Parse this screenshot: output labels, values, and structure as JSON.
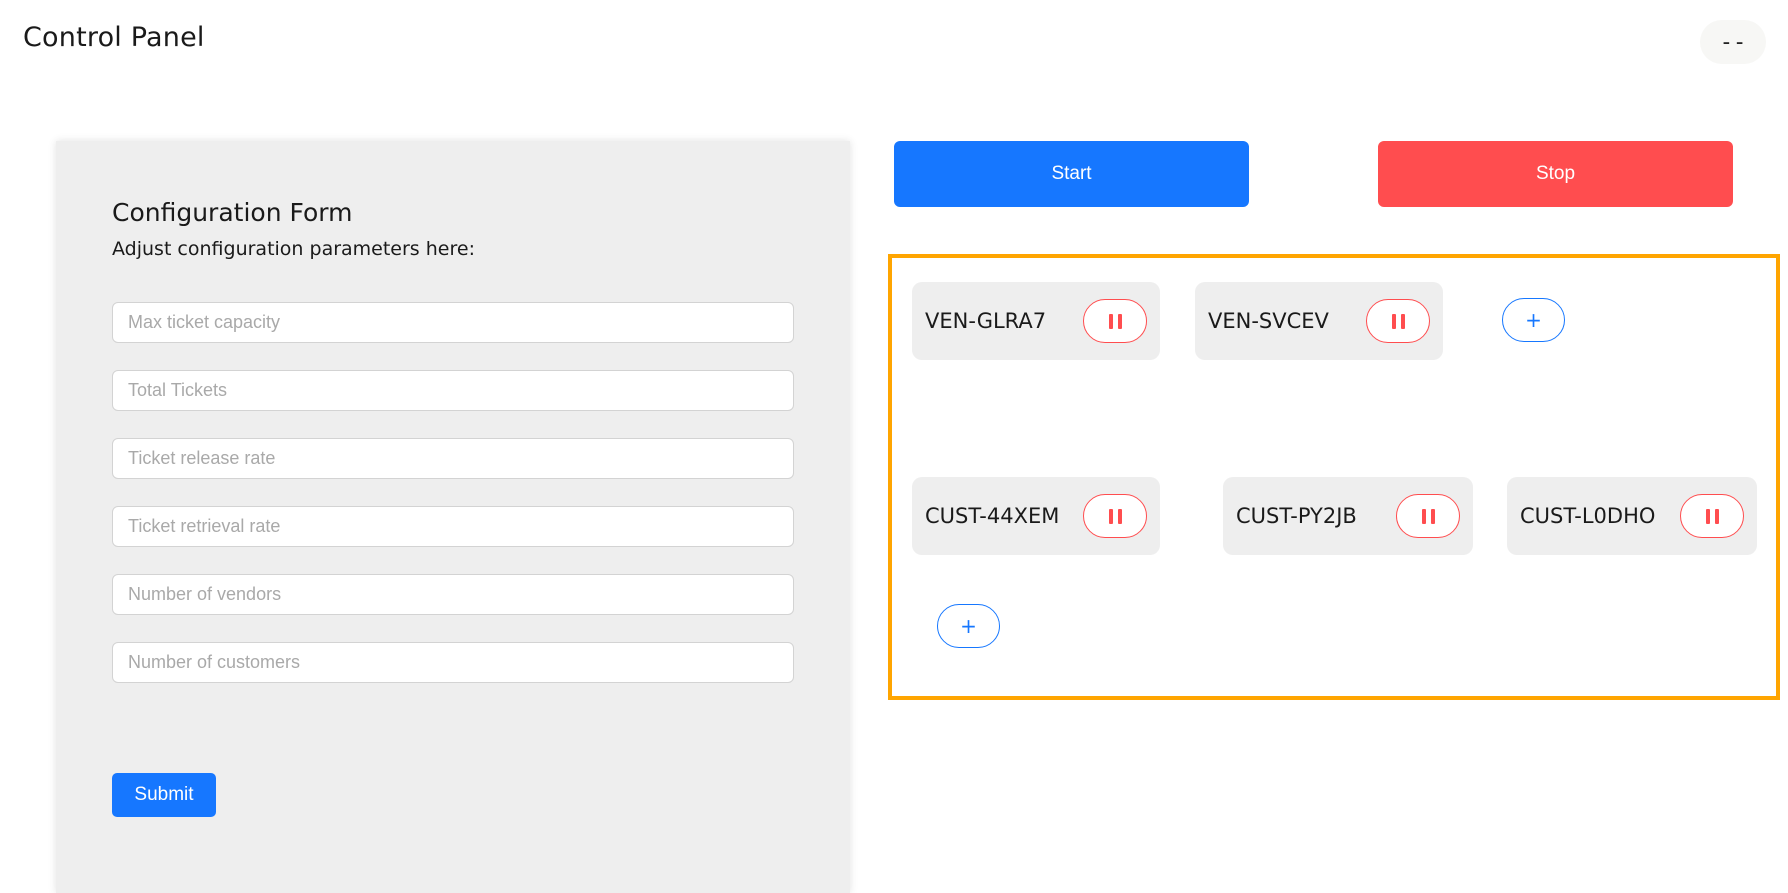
{
  "header": {
    "title": "Control Panel",
    "user_label": "--"
  },
  "form": {
    "title": "Configuration Form",
    "subtitle": "Adjust configuration parameters here:",
    "fields": [
      {
        "placeholder": "Max ticket capacity",
        "value": ""
      },
      {
        "placeholder": "Total Tickets",
        "value": ""
      },
      {
        "placeholder": "Ticket release rate",
        "value": ""
      },
      {
        "placeholder": "Ticket retrieval rate",
        "value": ""
      },
      {
        "placeholder": "Number of vendors",
        "value": ""
      },
      {
        "placeholder": "Number of customers",
        "value": ""
      }
    ],
    "submit_label": "Submit"
  },
  "actions": {
    "start_label": "Start",
    "stop_label": "Stop"
  },
  "vendors": [
    {
      "id": "VEN-GLRA7",
      "icon": "pause-icon"
    },
    {
      "id": "VEN-SVCEV",
      "icon": "pause-icon"
    }
  ],
  "customers": [
    {
      "id": "CUST-44XEM",
      "icon": "pause-icon"
    },
    {
      "id": "CUST-PY2JB",
      "icon": "pause-icon"
    },
    {
      "id": "CUST-L0DHO",
      "icon": "pause-icon"
    }
  ],
  "add_vendor_label": "+",
  "add_customer_label": "+",
  "colors": {
    "primary": "#1677ff",
    "danger": "#ff4d4f",
    "highlight_border": "#ffa500",
    "panel_bg": "#eeeeee"
  }
}
